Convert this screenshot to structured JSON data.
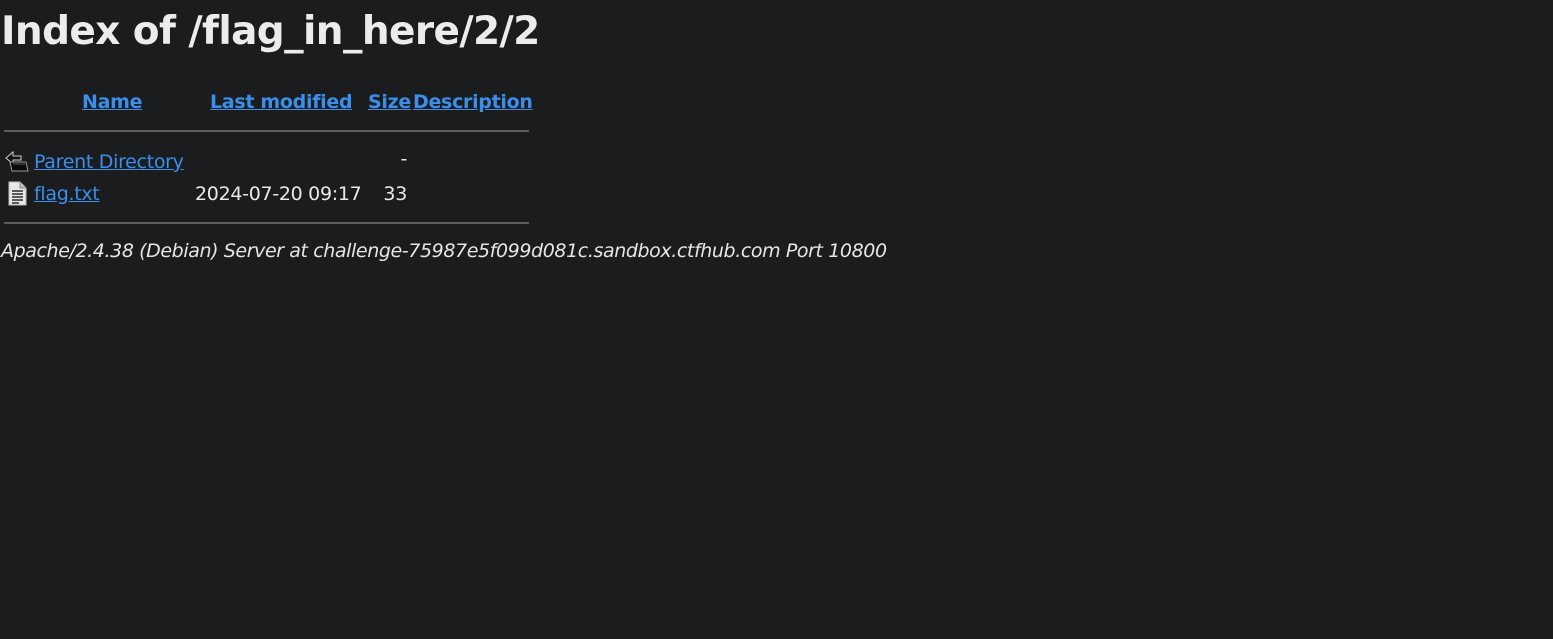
{
  "title": "Index of /flag_in_here/2/2",
  "columns": {
    "name": "Name",
    "last_modified": "Last modified",
    "size": "Size",
    "description": "Description"
  },
  "rows": [
    {
      "icon": "back-folder-icon",
      "name": "Parent Directory",
      "last_modified": "",
      "size": "-",
      "description": ""
    },
    {
      "icon": "text-file-icon",
      "name": "flag.txt",
      "last_modified": "2024-07-20 09:17",
      "size": "33",
      "description": ""
    }
  ],
  "address": "Apache/2.4.38 (Debian) Server at challenge-75987e5f099d081c.sandbox.ctfhub.com Port 10800",
  "colors": {
    "background": "#1b1c1e",
    "text": "#e9e9e9",
    "link": "#3b8eea"
  }
}
